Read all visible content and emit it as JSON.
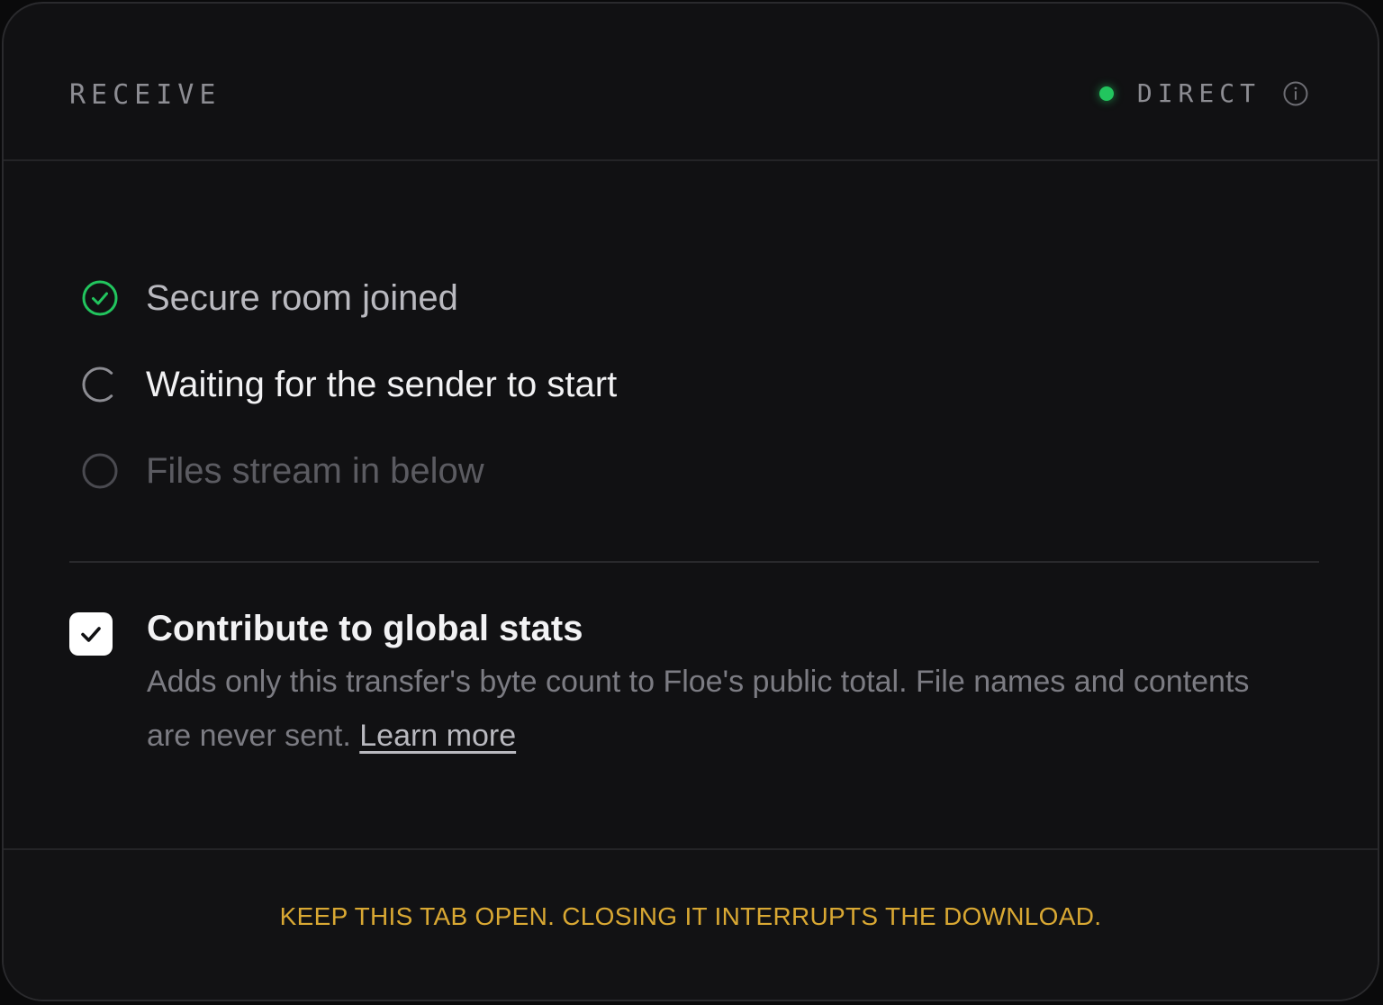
{
  "header": {
    "title": "RECEIVE",
    "status_label": "DIRECT",
    "status_color": "#22c55e",
    "info_icon": "info-icon"
  },
  "steps": [
    {
      "label": "Secure room joined",
      "state": "done",
      "icon": "check-circle-icon"
    },
    {
      "label": "Waiting for the sender to start",
      "state": "active",
      "icon": "spinner-icon"
    },
    {
      "label": "Files stream in below",
      "state": "pending",
      "icon": "empty-circle-icon"
    }
  ],
  "consent": {
    "checked": true,
    "title": "Contribute to global stats",
    "description": "Adds only this transfer's byte count to Floe's public total. File names and contents are never sent.",
    "link_label": "Learn more"
  },
  "footer": {
    "warning": "KEEP THIS TAB OPEN. CLOSING IT INTERRUPTS THE DOWNLOAD.",
    "warning_color": "#d9a833"
  }
}
